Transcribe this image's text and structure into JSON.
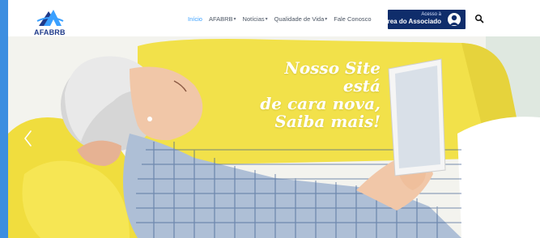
{
  "logo": {
    "text": "AFABRB"
  },
  "nav": {
    "items": [
      {
        "label": "Início",
        "dropdown": false,
        "active": true
      },
      {
        "label": "AFABRB",
        "dropdown": true,
        "active": false
      },
      {
        "label": "Notícias",
        "dropdown": true,
        "active": false
      },
      {
        "label": "Qualidade de Vida",
        "dropdown": true,
        "active": false
      },
      {
        "label": "Fale Conosco",
        "dropdown": false,
        "active": false
      }
    ]
  },
  "associate_button": {
    "small_label": "Acesso à",
    "big_label": "Área do Associado"
  },
  "hero": {
    "lines": [
      "Nosso Site está",
      "de cara nova,",
      "Saiba mais!"
    ]
  },
  "colors": {
    "accent": "#3aa0ff",
    "brand_navy": "#0f2d6b",
    "hero_yellow": "#f2e14a",
    "page_blue": "#3d8ee0"
  }
}
